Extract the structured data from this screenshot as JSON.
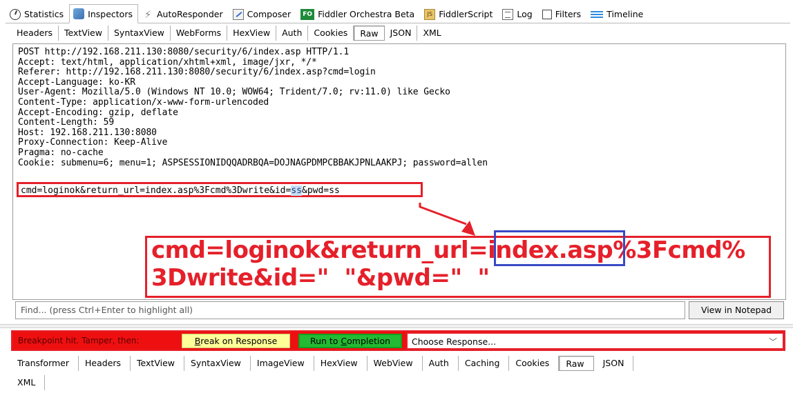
{
  "top_tabs": [
    {
      "label": "Statistics",
      "icon": "statistics-icon"
    },
    {
      "label": "Inspectors",
      "icon": "inspectors-icon"
    },
    {
      "label": "AutoResponder",
      "icon": "lightning-icon"
    },
    {
      "label": "Composer",
      "icon": "composer-icon"
    },
    {
      "label": "Fiddler Orchestra Beta",
      "icon": "fo-icon",
      "icon_text": "FO"
    },
    {
      "label": "FiddlerScript",
      "icon": "script-icon",
      "icon_text": "JS"
    },
    {
      "label": "Log",
      "icon": "log-icon"
    },
    {
      "label": "Filters",
      "icon": "checkbox-icon"
    },
    {
      "label": "Timeline",
      "icon": "timeline-icon"
    }
  ],
  "request_tabs": [
    "Headers",
    "TextView",
    "SyntaxView",
    "WebForms",
    "HexView",
    "Auth",
    "Cookies",
    "Raw",
    "JSON",
    "XML"
  ],
  "request_active_tab": "Raw",
  "raw_request": {
    "headers_text": "POST http://192.168.211.130:8080/security/6/index.asp HTTP/1.1\nAccept: text/html, application/xhtml+xml, image/jxr, */*\nReferer: http://192.168.211.130:8080/security/6/index.asp?cmd=login\nAccept-Language: ko-KR\nUser-Agent: Mozilla/5.0 (Windows NT 10.0; WOW64; Trident/7.0; rv:11.0) like Gecko\nContent-Type: application/x-www-form-urlencoded\nAccept-Encoding: gzip, deflate\nContent-Length: 59\nHost: 192.168.211.130:8080\nProxy-Connection: Keep-Alive\nPragma: no-cache\nCookie: submenu=6; menu=1; ASPSESSIONIDQQADRBQA=DOJNAGPDMPCBBAKJPNLAAKPJ; password=allen",
    "body_before": "cmd=loginok&return_url=index.asp%3Fcmd%3Dwrite&id=",
    "body_selected": "ss",
    "body_after": "&pwd=ss"
  },
  "callout": {
    "line1": "cmd=loginok&return_url=index.asp%3Fcmd%",
    "line2": "3Dwrite&id=\"  \"&pwd=\"  \"",
    "accent_color": "#e5202a",
    "box_color": "#3849c4"
  },
  "find": {
    "placeholder": "Find... (press Ctrl+Enter to highlight all)",
    "notepad_button": "View in Notepad"
  },
  "breakpoint": {
    "label": "Breakpoint hit. Tamper, then:",
    "break_on_response": "Break on Response",
    "run_to_completion": "Run to Completion",
    "choose_response": "Choose Response..."
  },
  "response_tabs_row1": [
    "Transformer",
    "Headers",
    "TextView",
    "SyntaxView",
    "ImageView",
    "HexView",
    "WebView",
    "Auth",
    "Caching",
    "Cookies",
    "Raw",
    "JSON"
  ],
  "response_tabs_row2": [
    "XML"
  ],
  "response_active_tab": "Raw"
}
